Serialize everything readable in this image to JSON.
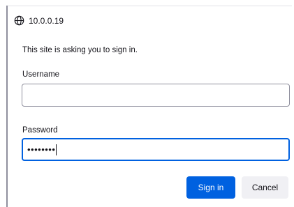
{
  "dialog": {
    "origin": "10.0.0.19",
    "origin_icon": "globe-icon",
    "message": "This site is asking you to sign in.",
    "username_label": "Username",
    "username_value": "",
    "password_label": "Password",
    "password_value": "••••••••",
    "signin_label": "Sign in",
    "cancel_label": "Cancel"
  },
  "colors": {
    "accent": "#0061e0",
    "secondary_button": "#f0f0f4",
    "field_border": "#8f8f9d"
  }
}
